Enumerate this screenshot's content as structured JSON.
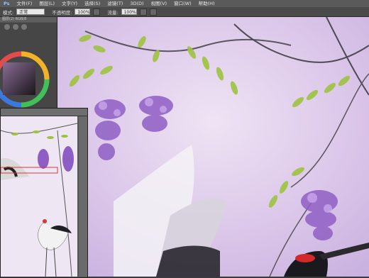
{
  "menu": [
    "Ps",
    "文件(F)",
    "图层(L)",
    "文字(Y)",
    "选择(S)",
    "滤镜(T)",
    "3D(D)",
    "视图(V)",
    "窗口(W)",
    "帮助(H)"
  ],
  "options": {
    "mode_label": "模式:",
    "mode_value": "正常",
    "opacity_label": "不透明度:",
    "opacity_value": "100%",
    "flow_label": "流量:",
    "flow_value": "100%"
  },
  "document_tab": "图层(2) RGB/8"
}
